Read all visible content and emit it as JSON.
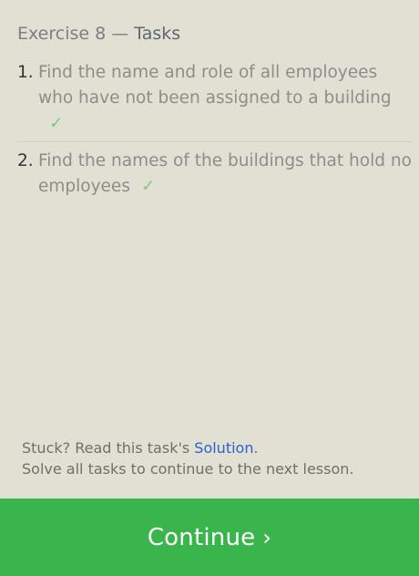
{
  "header": {
    "exercise": "Exercise 8",
    "separator": "—",
    "tasks_label": "Tasks"
  },
  "tasks": [
    {
      "number": "1.",
      "text": "Find the name and role of all employees who have not been assigned to a building",
      "check": "✓"
    },
    {
      "number": "2.",
      "text": "Find the names of the buildings that hold no employees",
      "check": "✓"
    }
  ],
  "footer": {
    "stuck_prefix": "Stuck? Read this task's ",
    "solution_link": "Solution",
    "stuck_suffix": ".",
    "solve_message": "Solve all tasks to continue to the next lesson."
  },
  "continue_button": {
    "label": "Continue",
    "chevron": "›"
  }
}
